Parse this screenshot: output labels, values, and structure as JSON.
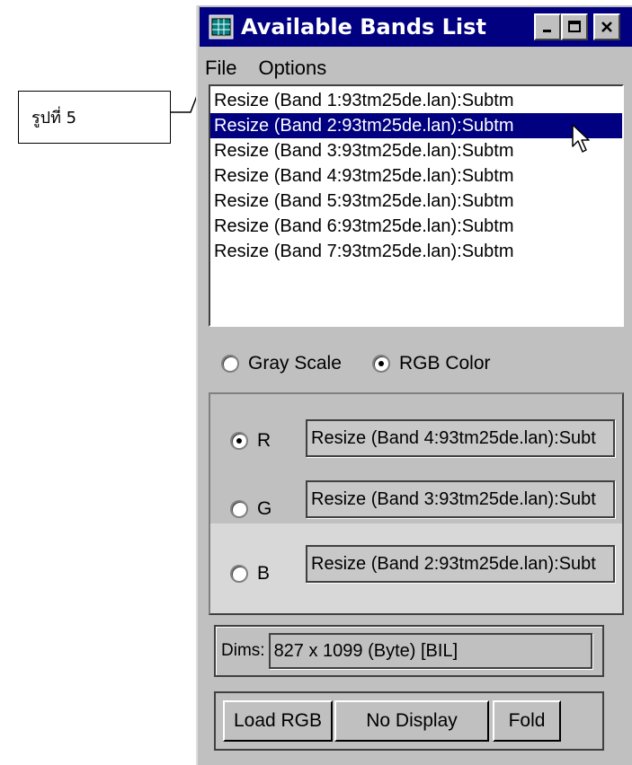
{
  "callout": {
    "label": "รูปที่ 5"
  },
  "window": {
    "title": "Available Bands List",
    "controls": {
      "minimize": "minimize-icon",
      "maximize": "maximize-icon",
      "close": "close-icon"
    }
  },
  "menu": {
    "items": [
      "File",
      "Options"
    ]
  },
  "band_list": {
    "items": [
      "Resize (Band 1:93tm25de.lan):Subtm",
      "Resize (Band 2:93tm25de.lan):Subtm",
      "Resize (Band 3:93tm25de.lan):Subtm",
      "Resize (Band 4:93tm25de.lan):Subtm",
      "Resize (Band 5:93tm25de.lan):Subtm",
      "Resize (Band 6:93tm25de.lan):Subtm",
      "Resize (Band 7:93tm25de.lan):Subtm"
    ],
    "selected_index": 1
  },
  "mode": {
    "gray_label": "Gray Scale",
    "rgb_label": "RGB Color",
    "selected": "RGB Color"
  },
  "channels": {
    "r": {
      "label": "R",
      "value": "Resize (Band 4:93tm25de.lan):Subt",
      "checked": true
    },
    "g": {
      "label": "G",
      "value": "Resize (Band 3:93tm25de.lan):Subt",
      "checked": false
    },
    "b": {
      "label": "B",
      "value": "Resize (Band 2:93tm25de.lan):Subt",
      "checked": false
    }
  },
  "dims": {
    "label": "Dims:",
    "value": "827 x 1099 (Byte) [BIL]"
  },
  "buttons": {
    "load": "Load RGB",
    "no_display": "No Display",
    "fold": "Fold"
  },
  "colors": {
    "titlebar": "#000080",
    "selection": "#000080",
    "face": "#c0c0c0"
  }
}
